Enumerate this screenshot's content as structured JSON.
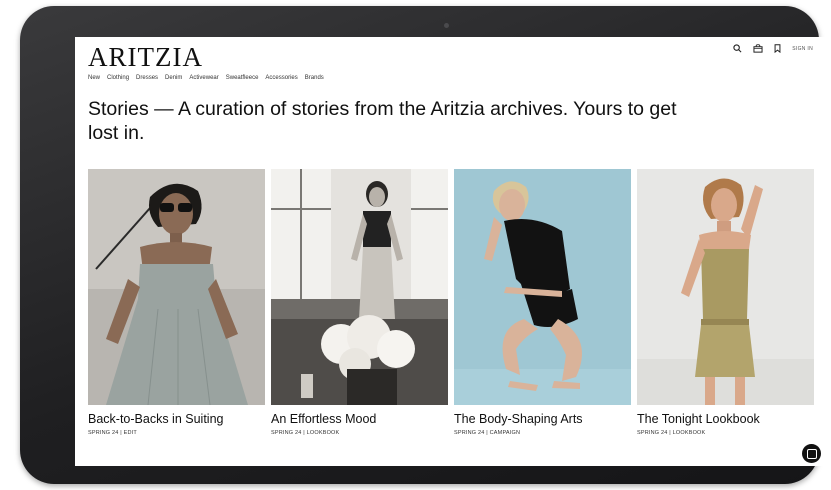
{
  "brand": {
    "logo": "ARITZIA"
  },
  "nav": {
    "items": [
      "New",
      "Clothing",
      "Dresses",
      "Denim",
      "Activewear",
      "Sweatfleece",
      "Accessories",
      "Brands"
    ]
  },
  "header_tools": {
    "search_icon": "search-icon",
    "bag_icon": "shopping-bag-icon",
    "bookmark_icon": "bookmark-icon",
    "sign_in_label": "SIGN IN"
  },
  "headline": "Stories — A curation of stories from the Aritzia archives. Yours to get lost in.",
  "stories": [
    {
      "title": "Back-to-Backs in Suiting",
      "meta": "SPRING 24 | EDIT",
      "palette": {
        "bg": "#c9c6c1",
        "garment": "#9aa3a0",
        "skin": "#8a6a55",
        "hair": "#1c1a18"
      }
    },
    {
      "title": "An Effortless Mood",
      "meta": "SPRING 24 | LOOKBOOK",
      "palette": {
        "bg": "#e4e2de",
        "garment": "#222222",
        "skin": "#b8b2aa",
        "hair": "#2a2826"
      }
    },
    {
      "title": "The Body-Shaping Arts",
      "meta": "SPRING 24 | CAMPAIGN",
      "palette": {
        "bg": "#9fc7d3",
        "garment": "#121212",
        "skin": "#d9b39a",
        "hair": "#d8c59a"
      }
    },
    {
      "title": "The Tonight Lookbook",
      "meta": "SPRING 24 | LOOKBOOK",
      "palette": {
        "bg": "#e7e7e5",
        "garment": "#a99a62",
        "skin": "#d9a88a",
        "hair": "#b07a4a"
      }
    }
  ],
  "chat": {
    "icon": "chat-icon"
  }
}
